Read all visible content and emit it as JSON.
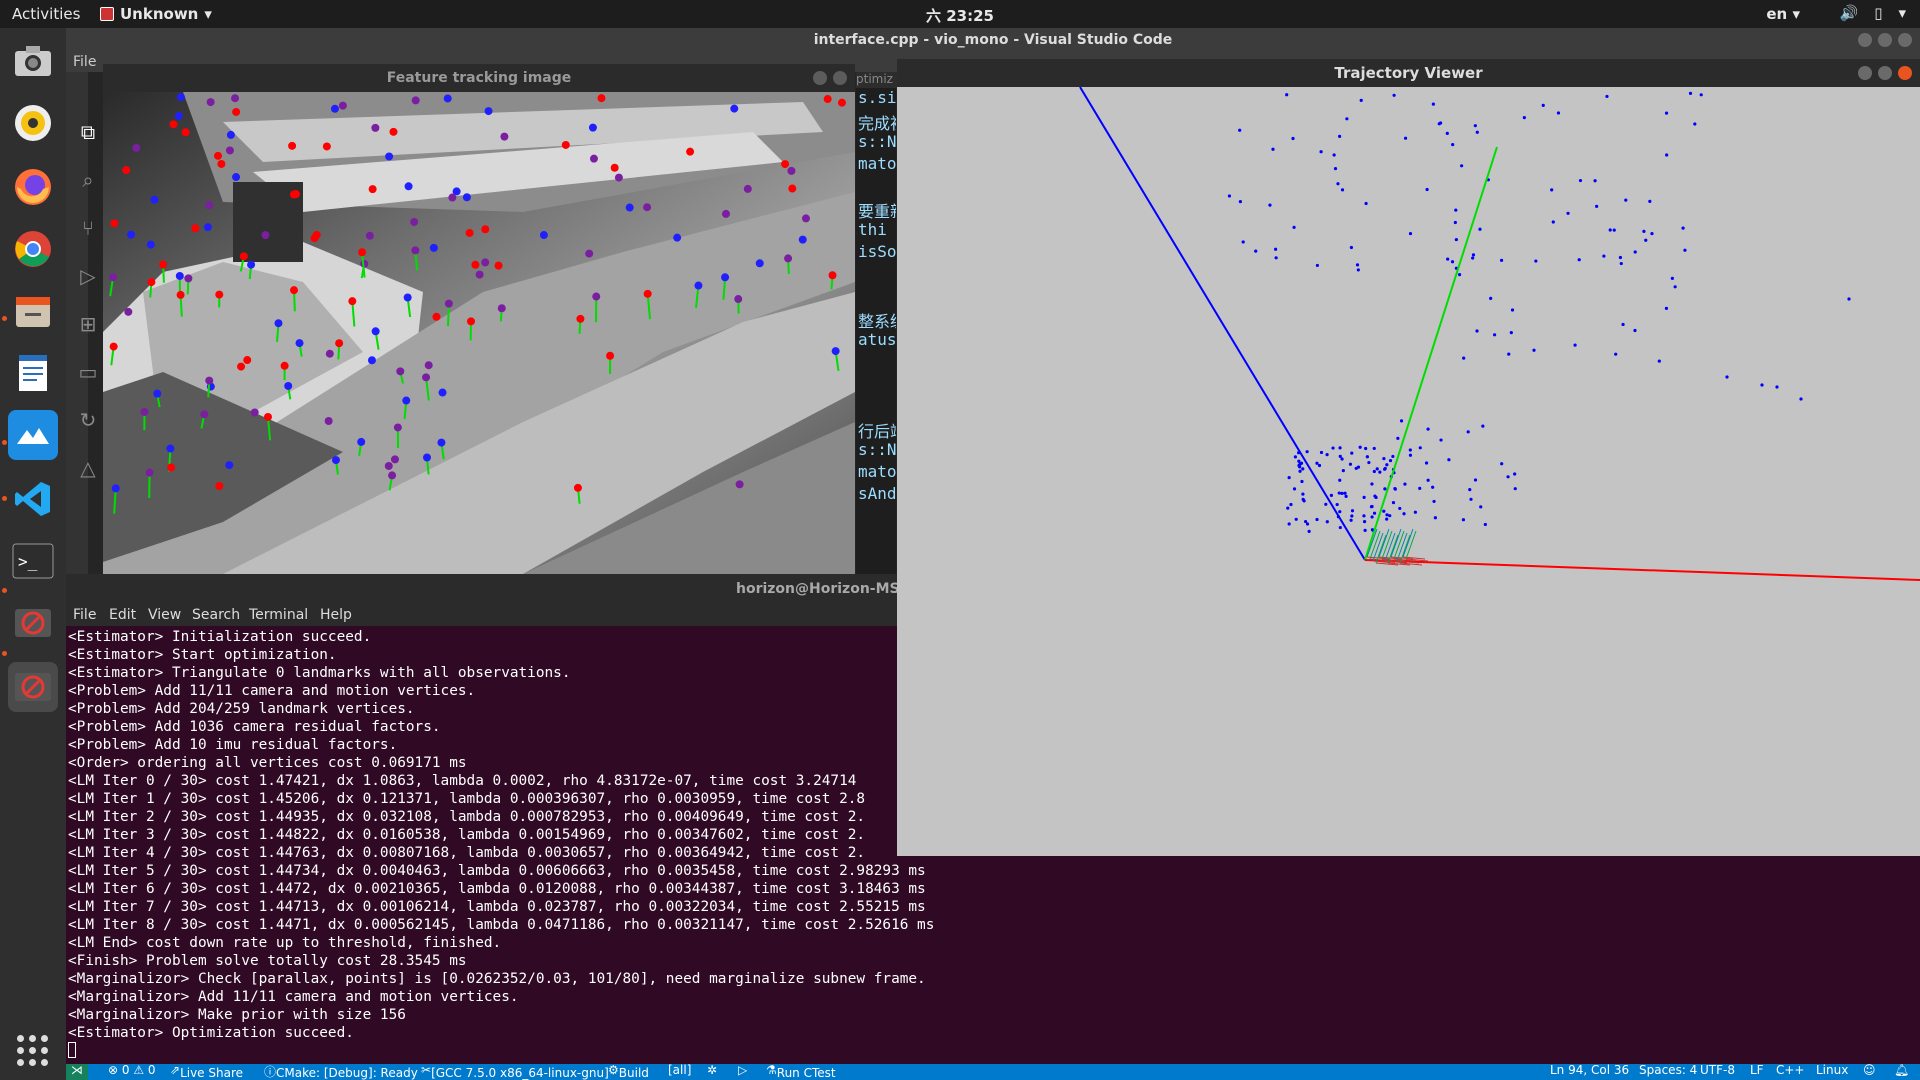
{
  "topbar": {
    "activities": "Activities",
    "app_menu": "Unknown",
    "clock": "六 23:25",
    "lang": "en"
  },
  "vscode": {
    "title": "interface.cpp - vio_mono - Visual Studio Code",
    "menu_file": "File",
    "editor_lines": [
      "s.si",
      "完成初",
      "s::N",
      "mato",
      "",
      "要重新",
      " thi",
      "isSo",
      "",
      "",
      "整系统",
      "atus",
      "",
      "",
      "",
      "行后端",
      "s::N",
      "mato",
      "sAnd"
    ],
    "editor_tab_fragment": "ptimiz",
    "status": {
      "problems": "⊗ 0 ⚠ 0",
      "live_share": "Live Share",
      "cmake": "CMake: [Debug]: Ready",
      "kit": "[GCC 7.5.0 x86_64-linux-gnu]",
      "build": "Build",
      "target": "[all]",
      "run_ctest": "Run CTest",
      "position": "Ln 94, Col 36",
      "spaces": "Spaces: 4",
      "encoding": "UTF-8",
      "eol": "LF",
      "language": "C++",
      "platform": "Linux"
    }
  },
  "feature_window": {
    "title": "Feature tracking image"
  },
  "terminal": {
    "title": "horizon@Horizon-MSI-",
    "menu": [
      "File",
      "Edit",
      "View",
      "Search",
      "Terminal",
      "Help"
    ],
    "lines": [
      "<Estimator> Initialization succeed.",
      "<Estimator> Start optimization.",
      "<Estimator> Triangulate 0 landmarks with all observations.",
      "<Problem> Add 11/11 camera and motion vertices.",
      "<Problem> Add 204/259 landmark vertices.",
      "<Problem> Add 1036 camera residual factors.",
      "<Problem> Add 10 imu residual factors.",
      "<Order> ordering all vertices cost 0.069171 ms",
      "<LM Iter 0 / 30> cost 1.47421, dx 1.0863, lambda 0.0002, rho 4.83172e-07, time cost 3.24714",
      "<LM Iter 1 / 30> cost 1.45206, dx 0.121371, lambda 0.000396307, rho 0.0030959, time cost 2.8",
      "<LM Iter 2 / 30> cost 1.44935, dx 0.032108, lambda 0.000782953, rho 0.00409649, time cost 2.",
      "<LM Iter 3 / 30> cost 1.44822, dx 0.0160538, lambda 0.00154969, rho 0.00347602, time cost 2.",
      "<LM Iter 4 / 30> cost 1.44763, dx 0.00807168, lambda 0.0030657, rho 0.00364942, time cost 2.",
      "<LM Iter 5 / 30> cost 1.44734, dx 0.0040463, lambda 0.00606663, rho 0.0035458, time cost 2.98293 ms",
      "<LM Iter 6 / 30> cost 1.4472, dx 0.00210365, lambda 0.0120088, rho 0.00344387, time cost 3.18463 ms",
      "<LM Iter 7 / 30> cost 1.44713, dx 0.00106214, lambda 0.023787, rho 0.00322034, time cost 2.55215 ms",
      "<LM Iter 8 / 30> cost 1.4471, dx 0.000562145, lambda 0.0471186, rho 0.00321147, time cost 2.52616 ms",
      "<LM End> cost down rate up to threshold, finished.",
      "<Finish> Problem solve totally cost 28.3545 ms",
      "<Marginalizor> Check [parallax, points] is [0.0262352/0.03, 101/80], need marginalize subnew frame.",
      "<Marginalizor> Add 11/11 camera and motion vertices.",
      "<Marginalizor> Make prior with size 156",
      "<Estimator> Optimization succeed."
    ]
  },
  "trajectory_window": {
    "title": "Trajectory Viewer"
  },
  "colors": {
    "terminal_bg": "#300a24",
    "status_bar": "#007acc",
    "viewer_bg": "#c4c4c4",
    "axis_x": "#ff0000",
    "axis_y": "#00dd00",
    "axis_z": "#0000ff",
    "landmark": "#0000ff",
    "ubuntu_accent": "#e95420"
  },
  "dock_icons": [
    "camera-app-icon",
    "rhythmbox-icon",
    "firefox-icon",
    "chrome-icon",
    "files-icon",
    "text-editor-icon",
    "remote-desktop-icon",
    "vscode-icon",
    "terminal-icon",
    "no-entry-icon",
    "no-entry-icon-active",
    "show-apps-icon"
  ]
}
